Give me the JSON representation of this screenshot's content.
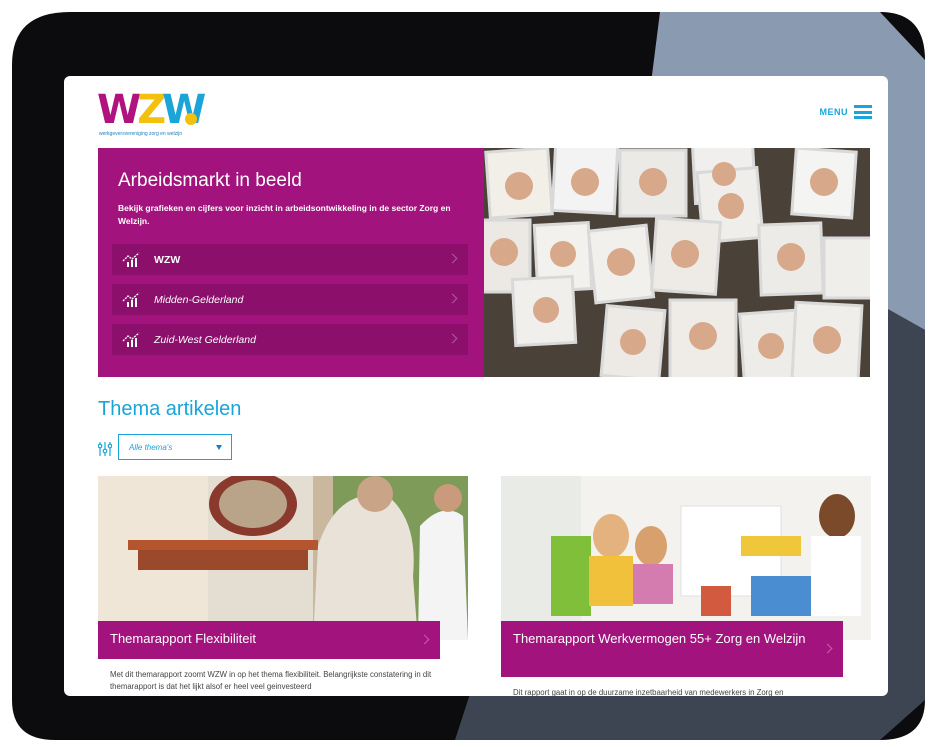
{
  "header": {
    "logo_text": [
      "W",
      "Z",
      "W"
    ],
    "logo_tagline": "werkgeversvereniging zorg en welzijn",
    "menu_label": "MENU"
  },
  "hero": {
    "title": "Arbeidsmarkt in beeld",
    "subtitle": "Bekijk grafieken en cijfers voor inzicht in arbeidsontwikkeling in de sector Zorg en Welzijn.",
    "regions": [
      {
        "label": "WZW",
        "icon": "chart-icon"
      },
      {
        "label": "Midden-Gelderland",
        "icon": "chart-icon"
      },
      {
        "label": "Zuid-West Gelderland",
        "icon": "chart-icon"
      }
    ]
  },
  "articles": {
    "section_title": "Thema artikelen",
    "filter": {
      "selected": "Alle thema's",
      "icon": "filter-sliders-icon"
    },
    "cards": [
      {
        "title": "Themarapport Flexibiliteit",
        "excerpt": "Met dit themarapport zoomt WZW in op het thema flexibiliteit. Belangrijkste constatering in dit themarapport is dat het lijkt alsof er heel veel geinvesteerd"
      },
      {
        "title": "Themarapport Werkvermogen 55+ Zorg en Welzijn",
        "excerpt": "Dit rapport gaat in op de duurzame inzetbaarheid van medewerkers in Zorg en"
      }
    ]
  },
  "colors": {
    "magenta": "#a3137d",
    "magenta_dark": "#8c0f6c",
    "accent_blue": "#1aa4d8"
  }
}
